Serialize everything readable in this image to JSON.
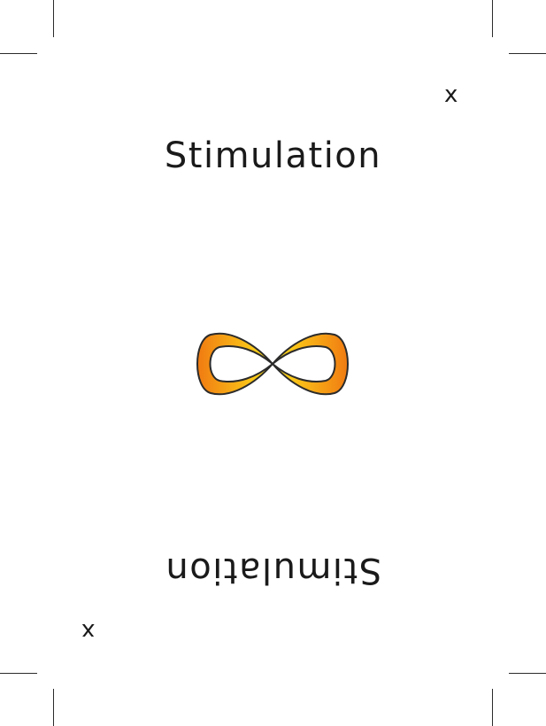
{
  "card": {
    "title": "Stimulation",
    "corner_mark": "x",
    "symbol_icon": "infinity-icon",
    "colors": {
      "symbol_outer": "#f07b12",
      "symbol_inner": "#ffe21a",
      "outline": "#2b2b2b"
    }
  }
}
